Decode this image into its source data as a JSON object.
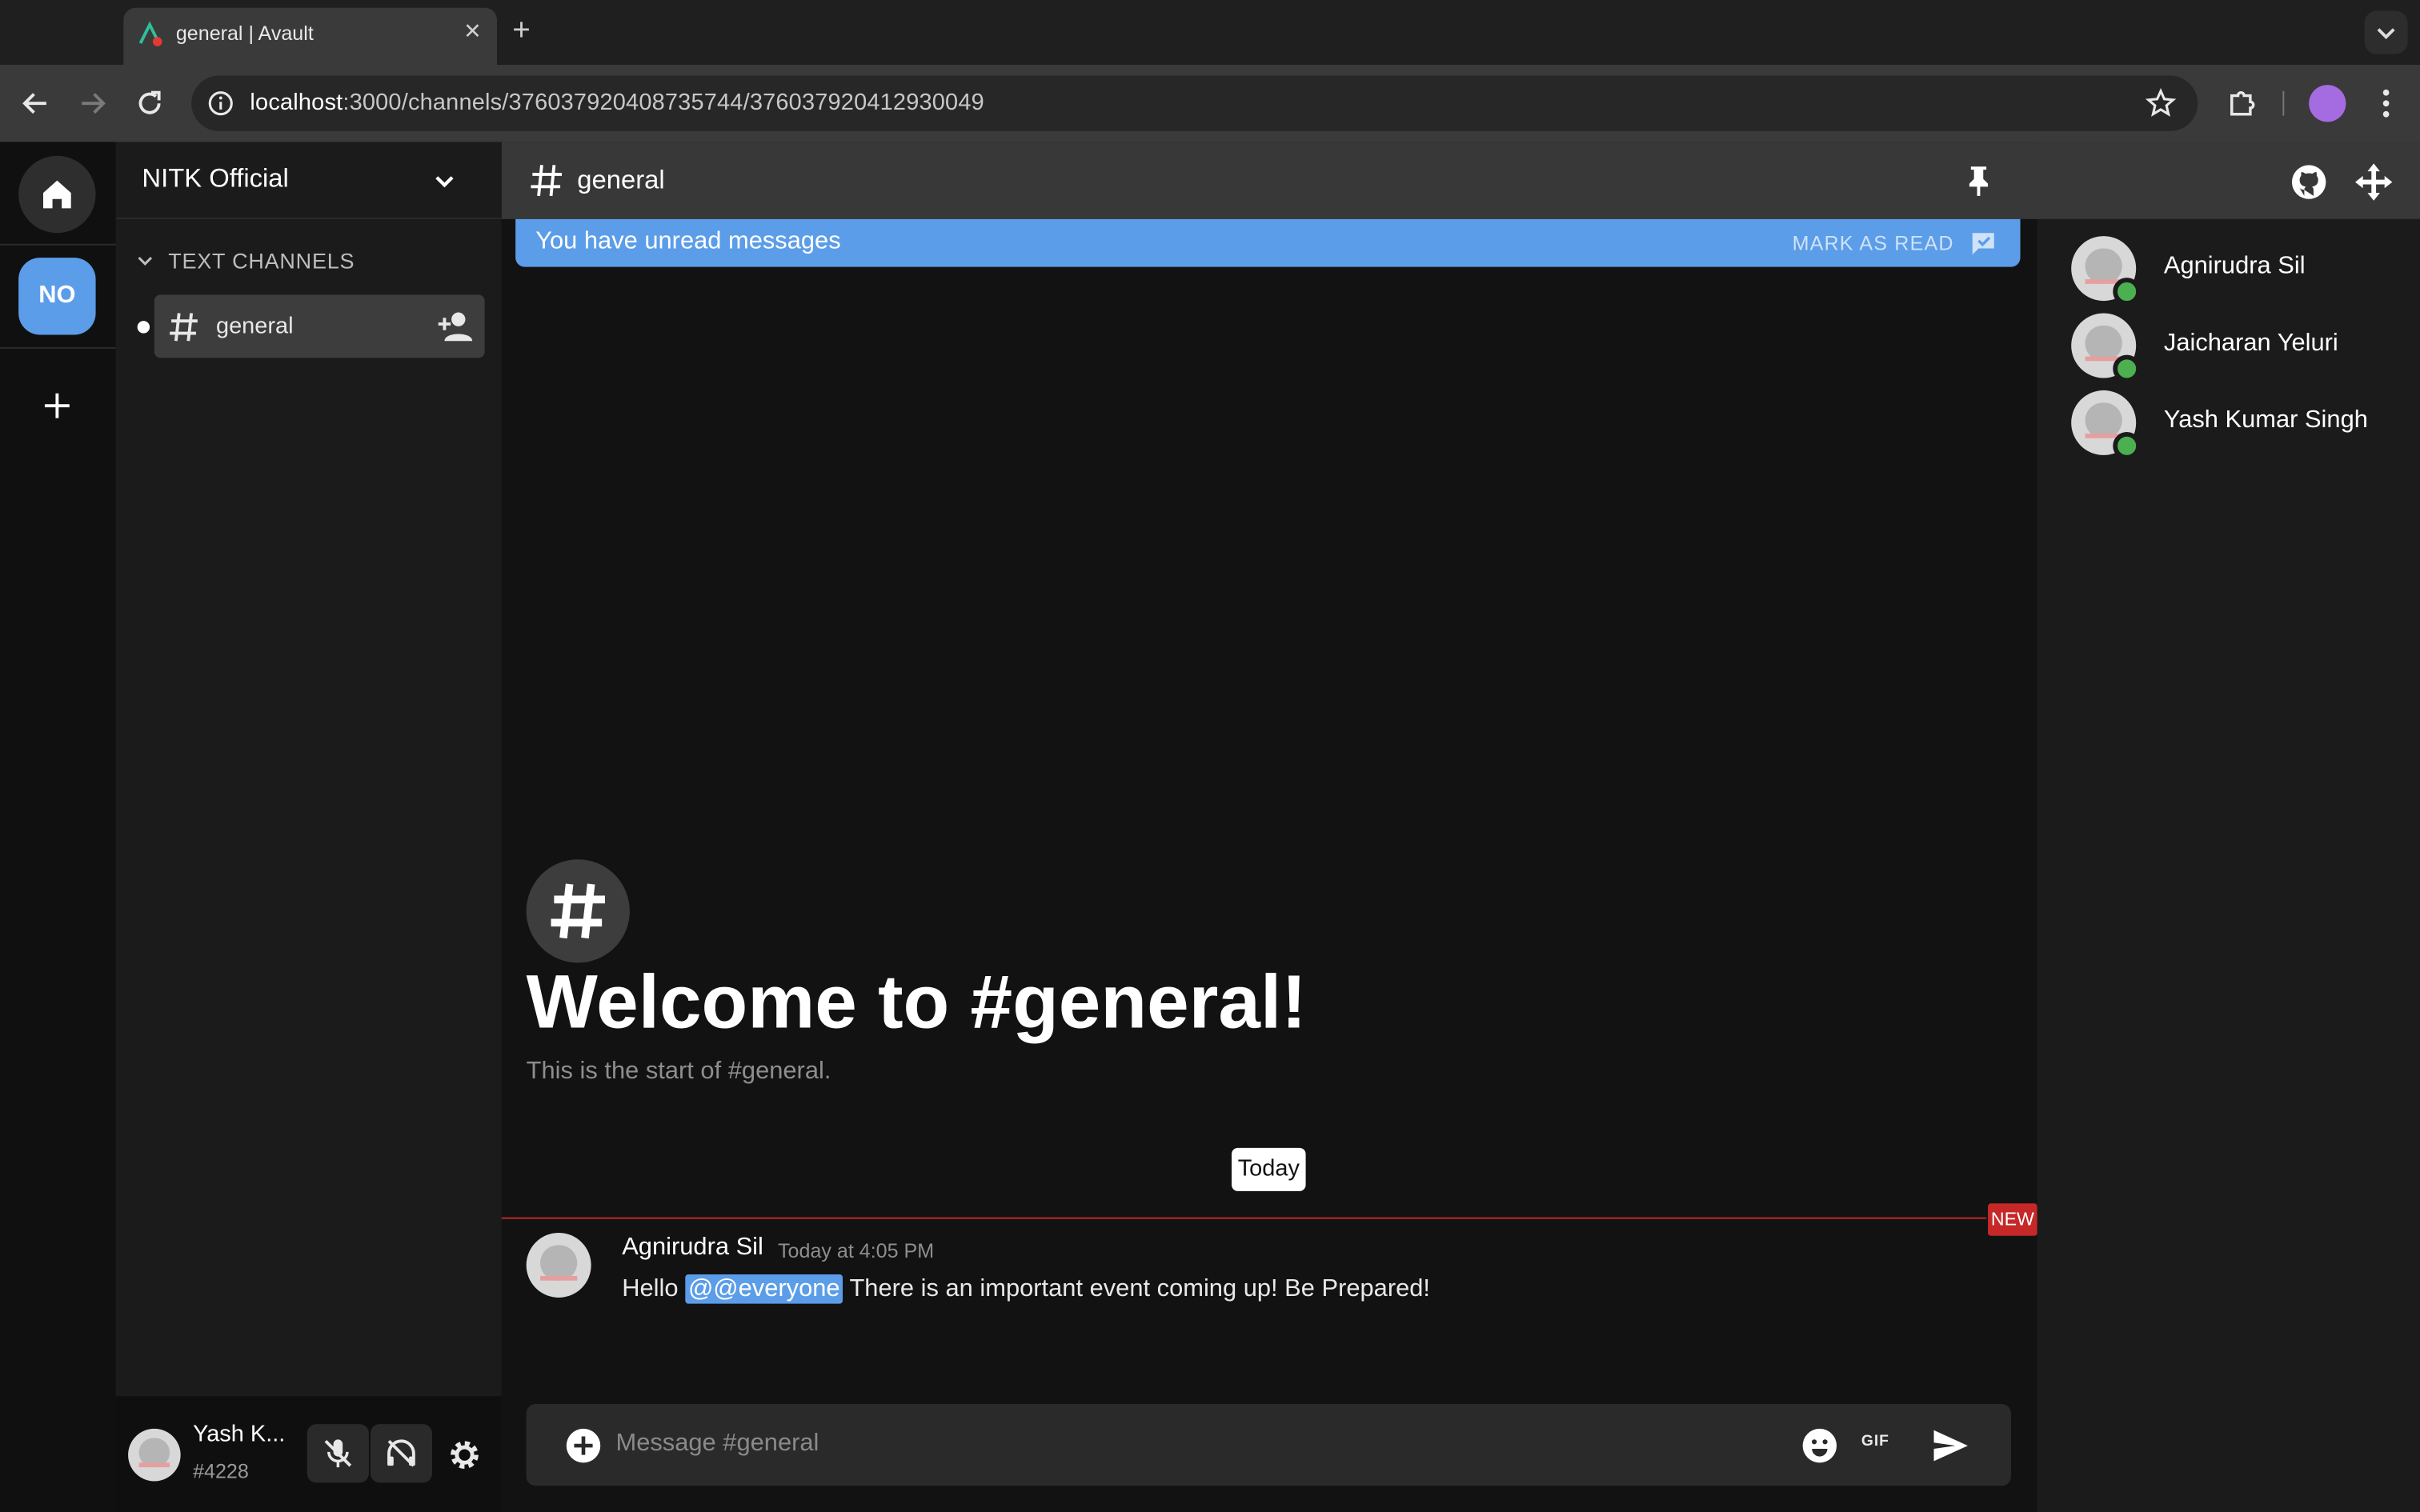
{
  "browser": {
    "tab_title": "general | Avault",
    "url_host": "localhost",
    "url_path": ":3000/channels/376037920408735744/376037920412930049"
  },
  "rail": {
    "server_initials": "NO"
  },
  "sidebar": {
    "server_name": "NITK Official",
    "category": "TEXT CHANNELS",
    "channels": [
      {
        "name": "general"
      }
    ],
    "user": {
      "name": "Yash K...",
      "tag": "#4228"
    }
  },
  "channel": {
    "name": "general",
    "unread_text": "You have unread messages",
    "mark_as_read": "MARK AS READ",
    "welcome_title": "Welcome to #general!",
    "welcome_sub": "This is the start of #general.",
    "date_divider": "Today",
    "new_badge": "NEW",
    "messages": [
      {
        "author": "Agnirudra Sil",
        "time": "Today at 4:05 PM",
        "text_before": "Hello ",
        "mention": "@@everyone",
        "text_after": " There is an important event coming up! Be Prepared!"
      }
    ],
    "composer_placeholder": "Message #general",
    "gif_label": "GIF"
  },
  "members": [
    {
      "name": "Agnirudra Sil",
      "status": "online"
    },
    {
      "name": "Jaicharan Yeluri",
      "status": "online"
    },
    {
      "name": "Yash Kumar Singh",
      "status": "online"
    }
  ],
  "colors": {
    "accent": "#5b9de8",
    "online": "#4caf50",
    "new_marker": "#c62828"
  }
}
